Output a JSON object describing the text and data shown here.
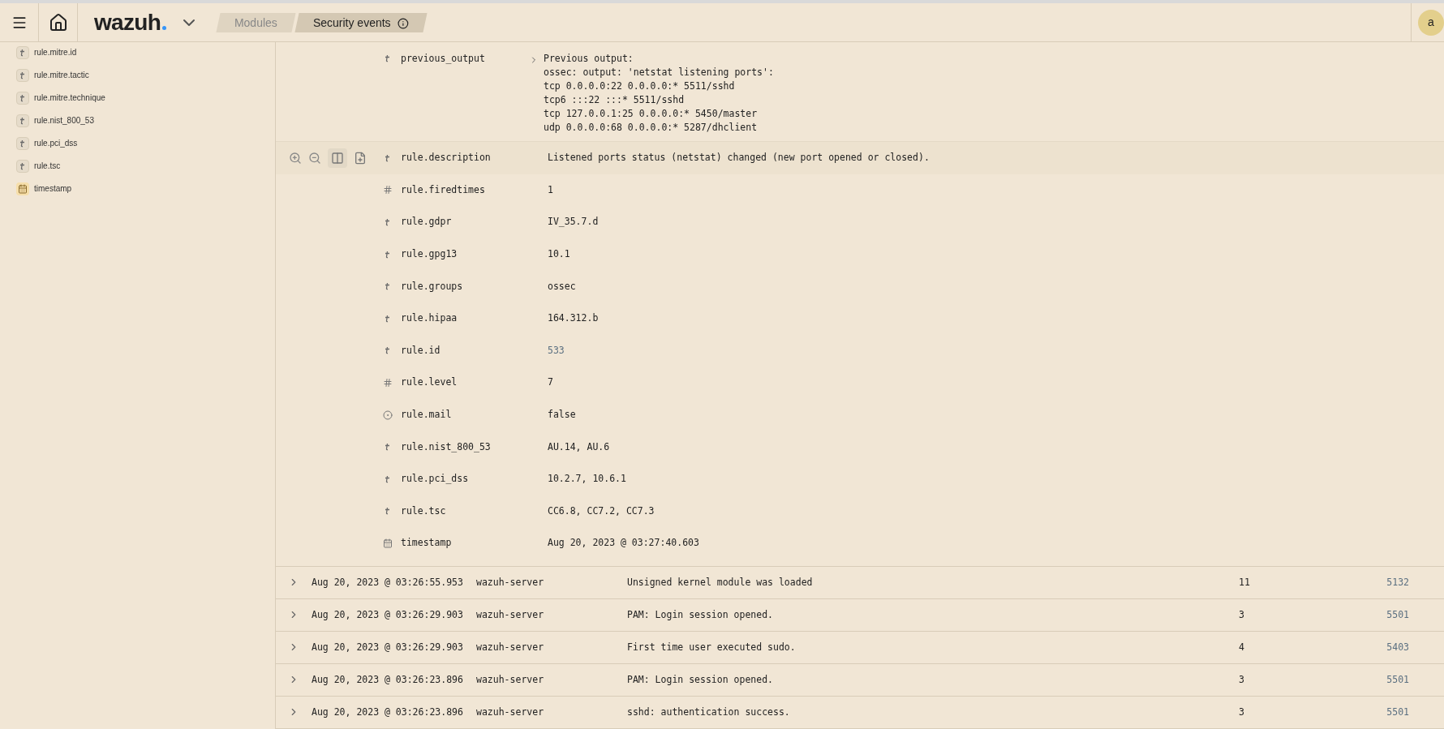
{
  "header": {
    "logo": "wazuh",
    "breadcrumbs": [
      {
        "label": "Modules",
        "selected": false
      },
      {
        "label": "Security events",
        "selected": true
      }
    ],
    "avatar": "a"
  },
  "sidebar": {
    "fields": [
      {
        "kind": "string",
        "name": "rule.mitre.id"
      },
      {
        "kind": "string",
        "name": "rule.mitre.tactic"
      },
      {
        "kind": "string",
        "name": "rule.mitre.technique"
      },
      {
        "kind": "string",
        "name": "rule.nist_800_53"
      },
      {
        "kind": "string",
        "name": "rule.pci_dss"
      },
      {
        "kind": "string",
        "name": "rule.tsc"
      },
      {
        "kind": "date",
        "name": "timestamp"
      }
    ]
  },
  "document": {
    "previous_output": {
      "name": "previous_output",
      "expanded": false,
      "lines": [
        "Previous output:",
        "ossec: output: 'netstat listening ports':",
        "tcp 0.0.0.0:22 0.0.0.0:* 5511/sshd",
        "tcp6 :::22 :::* 5511/sshd",
        "tcp 127.0.0.1:25 0.0.0.0:* 5450/master",
        "udp 0.0.0.0:68 0.0.0.0:* 5287/dhclient"
      ]
    },
    "fields": [
      {
        "kind": "string",
        "name": "rule.description",
        "value": "Listened ports status (netstat) changed (new port opened or closed).",
        "hovered": true,
        "link": false
      },
      {
        "kind": "number",
        "name": "rule.firedtimes",
        "value": "1",
        "hovered": false,
        "link": false
      },
      {
        "kind": "string",
        "name": "rule.gdpr",
        "value": "IV_35.7.d",
        "hovered": false,
        "link": false
      },
      {
        "kind": "string",
        "name": "rule.gpg13",
        "value": "10.1",
        "hovered": false,
        "link": false
      },
      {
        "kind": "string",
        "name": "rule.groups",
        "value": "ossec",
        "hovered": false,
        "link": false
      },
      {
        "kind": "string",
        "name": "rule.hipaa",
        "value": "164.312.b",
        "hovered": false,
        "link": false
      },
      {
        "kind": "string",
        "name": "rule.id",
        "value": "533",
        "hovered": false,
        "link": true
      },
      {
        "kind": "number",
        "name": "rule.level",
        "value": "7",
        "hovered": false,
        "link": false
      },
      {
        "kind": "boolean",
        "name": "rule.mail",
        "value": "false",
        "hovered": false,
        "link": false
      },
      {
        "kind": "string",
        "name": "rule.nist_800_53",
        "value": "AU.14, AU.6",
        "hovered": false,
        "link": false
      },
      {
        "kind": "string",
        "name": "rule.pci_dss",
        "value": "10.2.7, 10.6.1",
        "hovered": false,
        "link": false
      },
      {
        "kind": "string",
        "name": "rule.tsc",
        "value": "CC6.8, CC7.2, CC7.3",
        "hovered": false,
        "link": false
      },
      {
        "kind": "date",
        "name": "timestamp",
        "value": "Aug 20, 2023 @ 03:27:40.603",
        "hovered": false,
        "link": false
      }
    ]
  },
  "table": {
    "rows": [
      {
        "time": "Aug 20, 2023 @ 03:26:55.953",
        "agent": "wazuh-server",
        "description": "Unsigned kernel module was loaded",
        "level": "11",
        "rule_id": "5132",
        "expanded": false
      },
      {
        "time": "Aug 20, 2023 @ 03:26:29.903",
        "agent": "wazuh-server",
        "description": "PAM: Login session opened.",
        "level": "3",
        "rule_id": "5501",
        "expanded": false
      },
      {
        "time": "Aug 20, 2023 @ 03:26:29.903",
        "agent": "wazuh-server",
        "description": "First time user executed sudo.",
        "level": "4",
        "rule_id": "5403",
        "expanded": false
      },
      {
        "time": "Aug 20, 2023 @ 03:26:23.896",
        "agent": "wazuh-server",
        "description": "PAM: Login session opened.",
        "level": "3",
        "rule_id": "5501",
        "expanded": false
      },
      {
        "time": "Aug 20, 2023 @ 03:26:23.896",
        "agent": "wazuh-server",
        "description": "sshd: authentication success.",
        "level": "3",
        "rule_id": "5501",
        "expanded": false
      }
    ]
  }
}
